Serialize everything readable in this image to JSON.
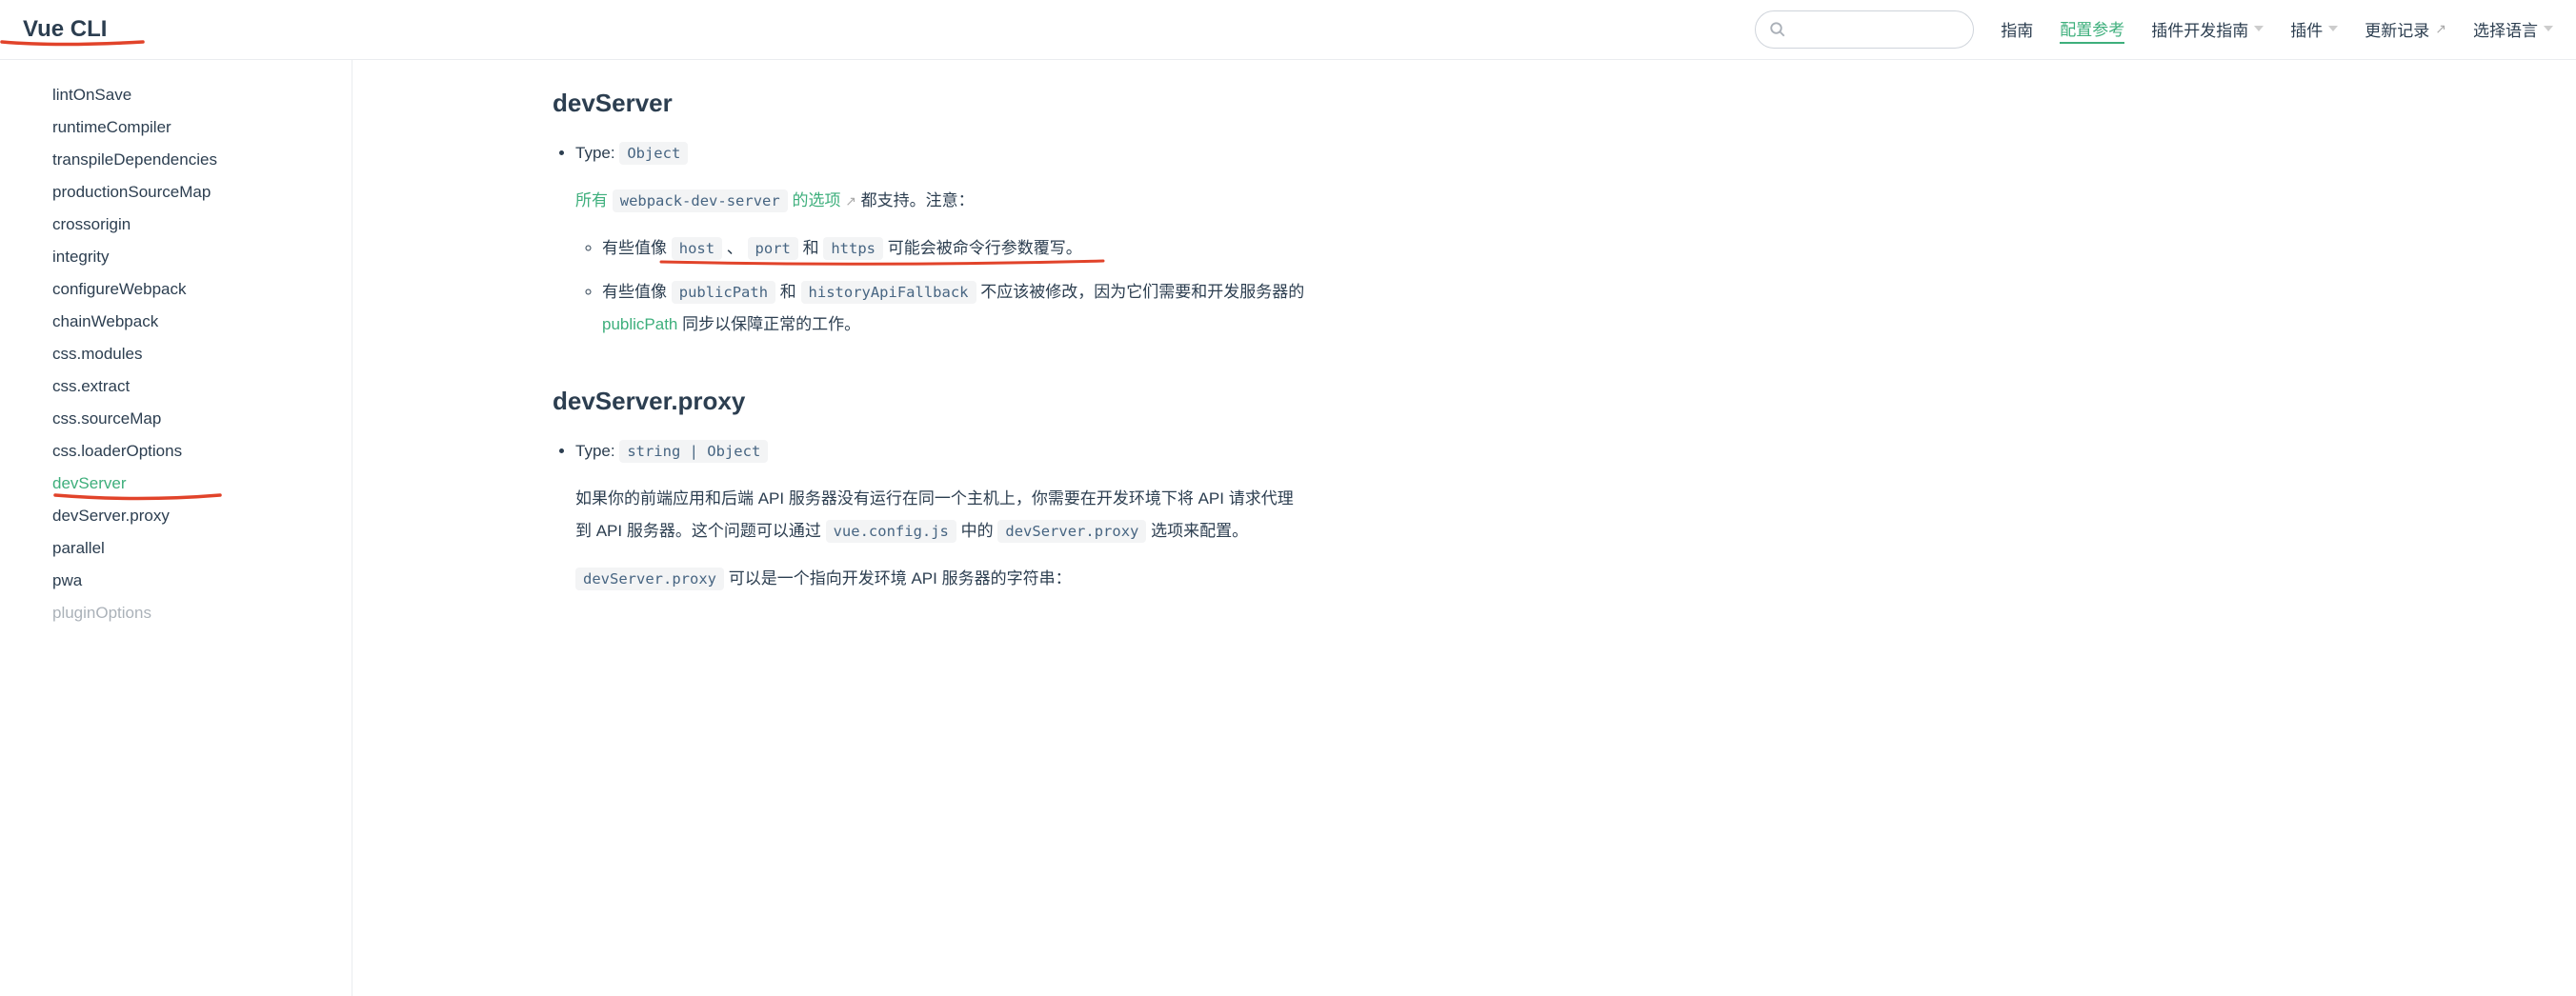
{
  "header": {
    "site_name": "Vue CLI",
    "nav": [
      {
        "label": "指南",
        "active": false,
        "dropdown": false,
        "ext": false
      },
      {
        "label": "配置参考",
        "active": true,
        "dropdown": false,
        "ext": false
      },
      {
        "label": "插件开发指南",
        "active": false,
        "dropdown": true,
        "ext": false
      },
      {
        "label": "插件",
        "active": false,
        "dropdown": true,
        "ext": false
      },
      {
        "label": "更新记录",
        "active": false,
        "dropdown": false,
        "ext": true
      },
      {
        "label": "选择语言",
        "active": false,
        "dropdown": true,
        "ext": false
      }
    ]
  },
  "sidebar": {
    "items": [
      {
        "label": "lintOnSave",
        "active": false
      },
      {
        "label": "runtimeCompiler",
        "active": false
      },
      {
        "label": "transpileDependencies",
        "active": false
      },
      {
        "label": "productionSourceMap",
        "active": false
      },
      {
        "label": "crossorigin",
        "active": false
      },
      {
        "label": "integrity",
        "active": false
      },
      {
        "label": "configureWebpack",
        "active": false
      },
      {
        "label": "chainWebpack",
        "active": false
      },
      {
        "label": "css.modules",
        "active": false
      },
      {
        "label": "css.extract",
        "active": false
      },
      {
        "label": "css.sourceMap",
        "active": false
      },
      {
        "label": "css.loaderOptions",
        "active": false
      },
      {
        "label": "devServer",
        "active": true
      },
      {
        "label": "devServer.proxy",
        "active": false
      },
      {
        "label": "parallel",
        "active": false
      },
      {
        "label": "pwa",
        "active": false
      },
      {
        "label": "pluginOptions",
        "active": false
      }
    ]
  },
  "content": {
    "section1": {
      "heading": "devServer",
      "type_label": "Type: ",
      "type_code": "Object",
      "intro_prefix": "所有 ",
      "intro_code": "webpack-dev-server",
      "intro_link": " 的选项",
      "intro_suffix": "都支持。注意：",
      "sub1_prefix": "有些值像 ",
      "sub1_code1": "host",
      "sub1_sep1": " 、 ",
      "sub1_code2": "port",
      "sub1_sep2": " 和 ",
      "sub1_code3": "https",
      "sub1_suffix": " 可能会被命令行参数覆写。",
      "sub2_prefix": "有些值像 ",
      "sub2_code1": "publicPath",
      "sub2_sep": " 和 ",
      "sub2_code2": "historyApiFallback",
      "sub2_mid": " 不应该被修改，因为它们需要和开发服务器的 ",
      "sub2_link": "publicPath",
      "sub2_suffix": " 同步以保障正常的工作。"
    },
    "section2": {
      "heading": "devServer.proxy",
      "type_label": "Type: ",
      "type_code": "string | Object",
      "para1_a": "如果你的前端应用和后端 API 服务器没有运行在同一个主机上，你需要在开发环境下将 API 请求代理到 API 服务器。这个问题可以通过 ",
      "para1_code1": "vue.config.js",
      "para1_b": " 中的 ",
      "para1_code2": "devServer.proxy",
      "para1_c": " 选项来配置。",
      "para2_code": "devServer.proxy",
      "para2_text": " 可以是一个指向开发环境 API 服务器的字符串："
    }
  }
}
